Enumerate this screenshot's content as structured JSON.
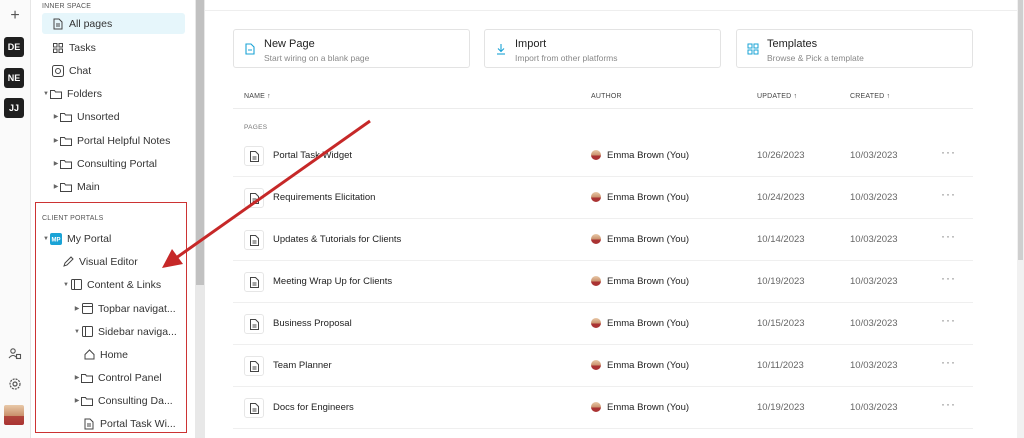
{
  "rail": {
    "workspaces": [
      "DE",
      "NE",
      "JJ"
    ]
  },
  "sidebar": {
    "inner_space_title": "INNER SPACE",
    "inner_items": {
      "all_pages": "All pages",
      "tasks": "Tasks",
      "chat": "Chat",
      "folders": "Folders",
      "unsorted": "Unsorted",
      "portal_helpful_notes": "Portal Helpful Notes",
      "consulting_portal": "Consulting Portal",
      "main": "Main"
    },
    "client_portals_title": "CLIENT PORTALS",
    "portal_items": {
      "my_portal": "My Portal",
      "visual_editor": "Visual Editor",
      "content_links": "Content & Links",
      "topbar_navigation": "Topbar navigat...",
      "sidebar_navigation": "Sidebar naviga...",
      "home": "Home",
      "control_panel": "Control Panel",
      "consulting_da": "Consulting Da...",
      "portal_task_wi": "Portal Task Wi..."
    }
  },
  "cards": {
    "new_page": {
      "title": "New Page",
      "subtitle": "Start wiring on a blank page"
    },
    "import": {
      "title": "Import",
      "subtitle": "Import from other platforms"
    },
    "templates": {
      "title": "Templates",
      "subtitle": "Browse & Pick a template"
    }
  },
  "table": {
    "headers": {
      "name": "NAME ↑",
      "author": "AUTHOR",
      "updated": "UPDATED ↑",
      "created": "CREATED ↑"
    },
    "section_label": "PAGES",
    "rows": [
      {
        "name": "Portal Task Widget",
        "author": "Emma Brown (You)",
        "updated": "10/26/2023",
        "created": "10/03/2023",
        "more": "···"
      },
      {
        "name": "Requirements Elicitation",
        "author": "Emma Brown (You)",
        "updated": "10/24/2023",
        "created": "10/03/2023",
        "more": "···"
      },
      {
        "name": "Updates & Tutorials for Clients",
        "author": "Emma Brown (You)",
        "updated": "10/14/2023",
        "created": "10/03/2023",
        "more": "···"
      },
      {
        "name": "Meeting Wrap Up for Clients",
        "author": "Emma Brown (You)",
        "updated": "10/19/2023",
        "created": "10/03/2023",
        "more": "···"
      },
      {
        "name": "Business Proposal",
        "author": "Emma Brown (You)",
        "updated": "10/15/2023",
        "created": "10/03/2023",
        "more": "···"
      },
      {
        "name": "Team Planner",
        "author": "Emma Brown (You)",
        "updated": "10/11/2023",
        "created": "10/03/2023",
        "more": "···"
      },
      {
        "name": "Docs for Engineers",
        "author": "Emma Brown (You)",
        "updated": "10/19/2023",
        "created": "10/03/2023",
        "more": "···"
      }
    ]
  },
  "colors": {
    "accent": "#1aa3d6",
    "active_bg": "#e6f6fb",
    "highlight_red": "#cc3333"
  }
}
